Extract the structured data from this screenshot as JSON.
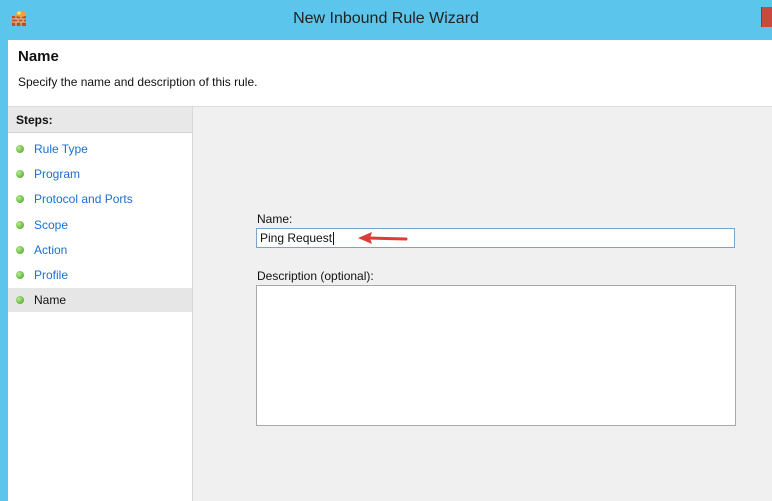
{
  "window": {
    "title": "New Inbound Rule Wizard",
    "icon": "firewall-icon",
    "accent_color": "#5bc5ec",
    "close_color": "#c9483f"
  },
  "header": {
    "title": "Name",
    "subtitle": "Specify the name and description of this rule."
  },
  "steps": {
    "heading": "Steps:",
    "items": [
      {
        "label": "Rule Type",
        "active": false
      },
      {
        "label": "Program",
        "active": false
      },
      {
        "label": "Protocol and Ports",
        "active": false
      },
      {
        "label": "Scope",
        "active": false
      },
      {
        "label": "Action",
        "active": false
      },
      {
        "label": "Profile",
        "active": false
      },
      {
        "label": "Name",
        "active": true
      }
    ],
    "link_color": "#1a6fd1",
    "dot_color": "#3e9c22"
  },
  "form": {
    "name_label": "Name:",
    "name_value": "Ping Request",
    "description_label": "Description (optional):",
    "description_value": ""
  },
  "annotation": {
    "icon": "red-arrow-icon",
    "color": "#e03b3b"
  }
}
